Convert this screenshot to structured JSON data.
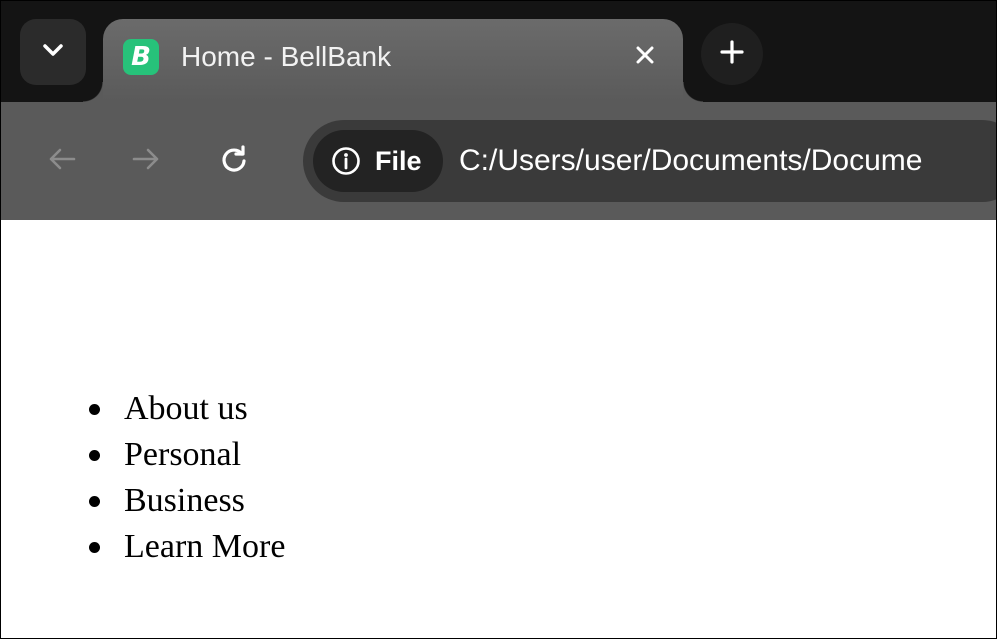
{
  "browser": {
    "tab": {
      "title": "Home - BellBank",
      "favicon_letter": "B",
      "favicon_color": "#27c27a"
    },
    "address_bar": {
      "scheme_chip_label": "File",
      "url": "C:/Users/user/Documents/Docume"
    },
    "icons": {
      "tab_search": "chevron-down-icon",
      "tab_close": "close-icon",
      "new_tab": "plus-icon",
      "back": "arrow-left-icon",
      "forward": "arrow-right-icon",
      "reload": "reload-icon",
      "info": "info-icon"
    }
  },
  "page": {
    "nav_items": [
      {
        "label": "About us"
      },
      {
        "label": "Personal"
      },
      {
        "label": "Business"
      },
      {
        "label": "Learn More"
      }
    ]
  }
}
